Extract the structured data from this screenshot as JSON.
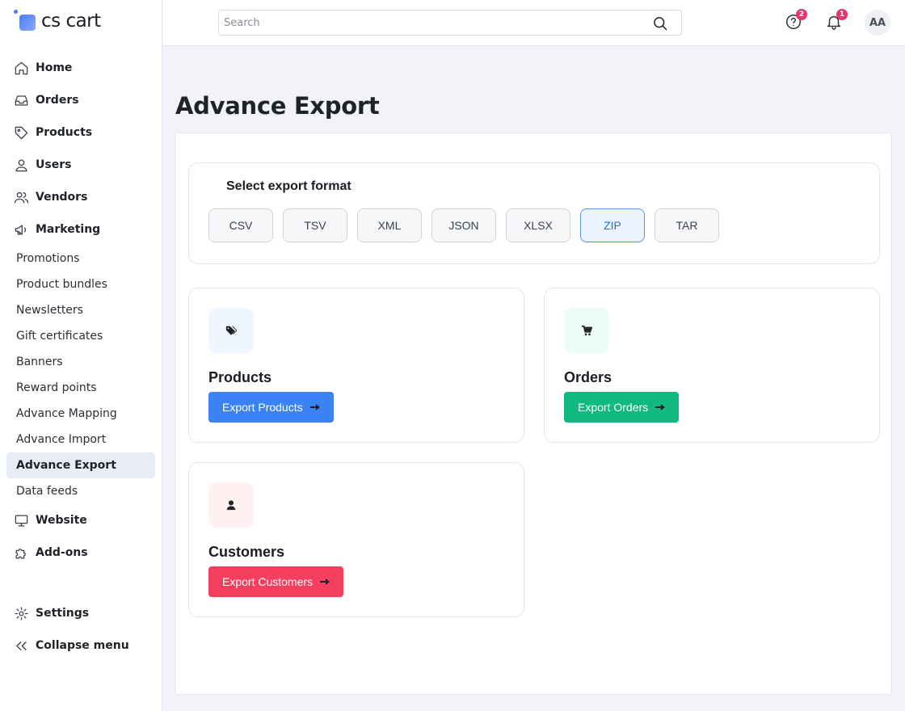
{
  "app": {
    "logo_text": "cs cart"
  },
  "header": {
    "search_placeholder": "Search",
    "help_badge": "2",
    "notifications_badge": "1",
    "avatar_initials": "AA"
  },
  "sidebar": {
    "home": "Home",
    "orders": "Orders",
    "products": "Products",
    "users": "Users",
    "vendors": "Vendors",
    "marketing": "Marketing",
    "marketing_items": [
      "Promotions",
      "Product bundles",
      "Newsletters",
      "Gift certificates",
      "Banners",
      "Reward points",
      "Advance Mapping",
      "Advance Import",
      "Advance Export",
      "Data feeds"
    ],
    "website": "Website",
    "addons": "Add-ons",
    "settings": "Settings",
    "collapse": "Collapse menu"
  },
  "main": {
    "title": "Advance Export",
    "format_title": "Select export format",
    "formats": [
      "CSV",
      "TSV",
      "XML",
      "JSON",
      "XLSX",
      "ZIP",
      "TAR"
    ],
    "selected_format": "ZIP",
    "cards": [
      {
        "title": "Products",
        "button": "Export Products",
        "color": "#3b82f6",
        "icon_bg": "#eff6ff",
        "icon": "tags-icon"
      },
      {
        "title": "Orders",
        "button": "Export Orders",
        "color": "#10b981",
        "icon_bg": "#ecfdf5",
        "icon": "cart-icon"
      },
      {
        "title": "Customers",
        "button": "Export Customers",
        "color": "#f43f5e",
        "icon_bg": "#fff1f2",
        "icon": "user-icon"
      }
    ]
  }
}
